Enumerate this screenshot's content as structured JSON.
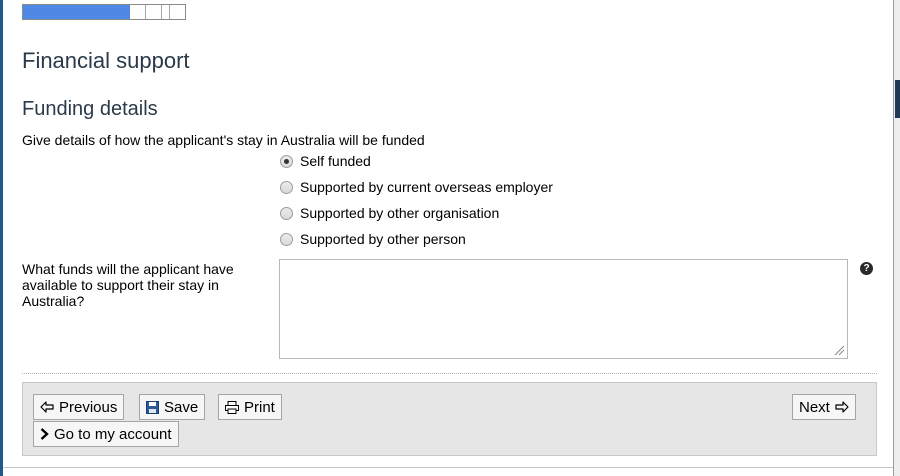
{
  "progress": {
    "completed_fraction": 0.66
  },
  "page": {
    "title": "Financial support",
    "section_title": "Funding details"
  },
  "funding": {
    "question": "Give details of how the applicant's stay in Australia will be funded",
    "selected": "Self funded",
    "options": [
      {
        "label": "Self funded",
        "checked": true
      },
      {
        "label": "Supported by current overseas employer",
        "checked": false
      },
      {
        "label": "Supported by other organisation",
        "checked": false
      },
      {
        "label": "Supported by other person",
        "checked": false
      }
    ]
  },
  "funds": {
    "label": "What funds will the applicant have available to support their stay in Australia?",
    "value": "",
    "help_icon": "?"
  },
  "buttons": {
    "previous": "Previous",
    "save": "Save",
    "print": "Print",
    "next": "Next",
    "account": "Go to my account"
  },
  "icons": [
    "arrow-left-icon",
    "save-icon",
    "print-icon",
    "arrow-right-icon",
    "chevron-right-icon",
    "help-icon",
    "resize-grip-icon"
  ],
  "colors": {
    "progress_fill": "#4f88e5",
    "heading": "#2b3a4a",
    "button_bar": "#e6e6e6",
    "accent_edge": "#1f5a8a"
  }
}
